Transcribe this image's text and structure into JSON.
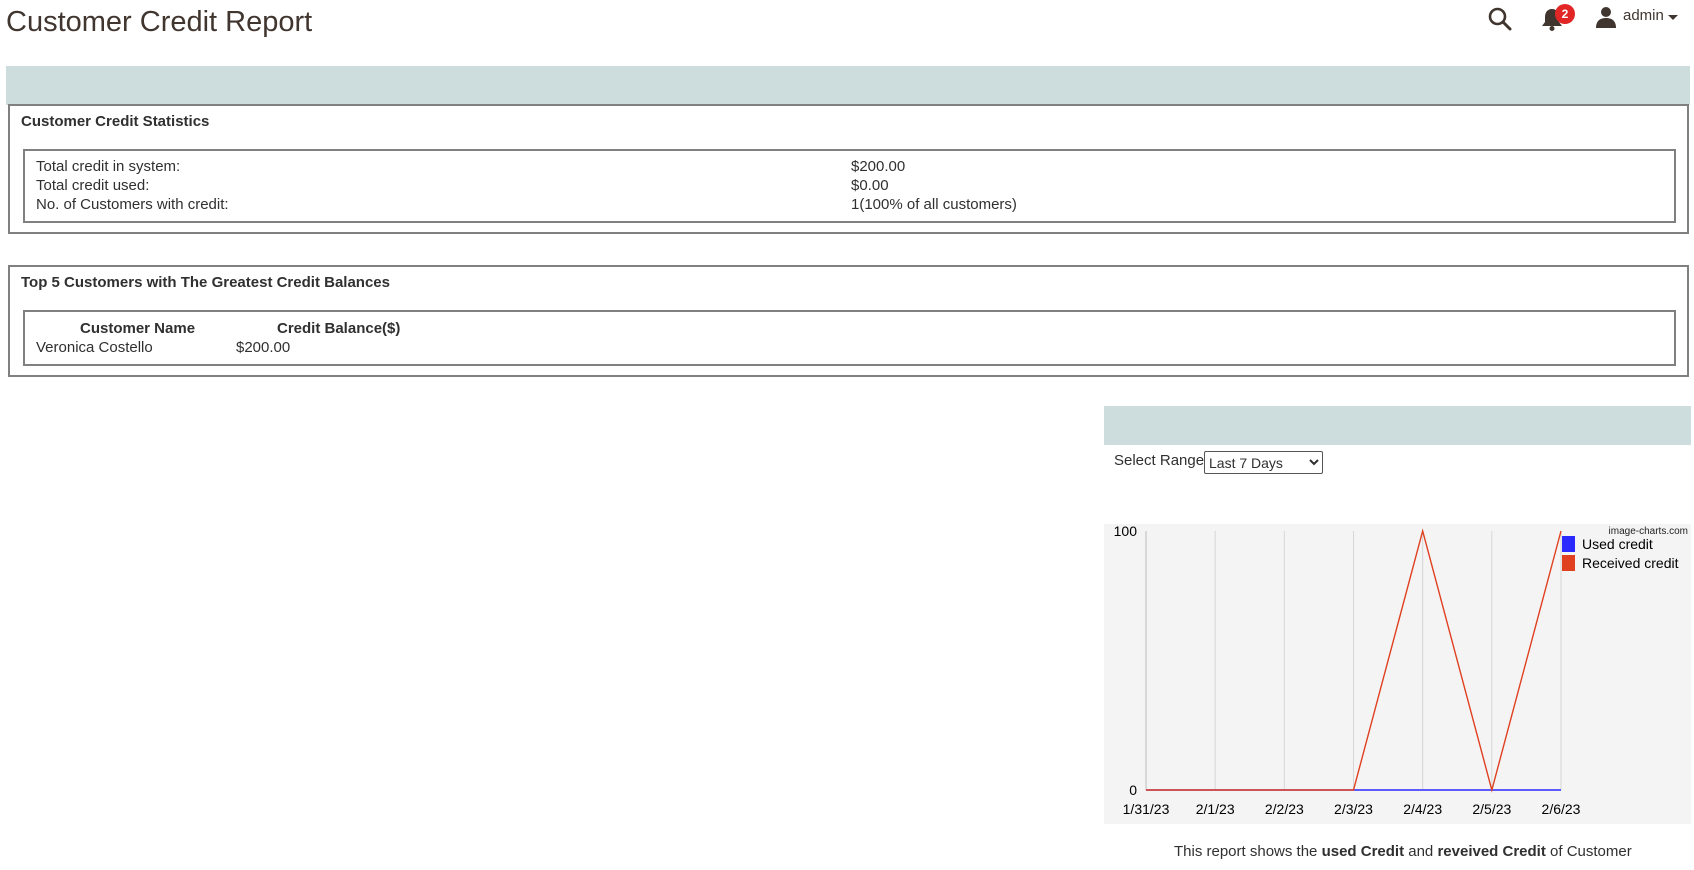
{
  "page": {
    "title": "Customer Credit Report"
  },
  "header": {
    "notification_count": "2",
    "user_name": "admin",
    "icons": {
      "search": "search-icon",
      "bell": "bell-icon",
      "user": "user-icon",
      "caret": "chevron-down-icon"
    }
  },
  "stats": {
    "title": "Customer Credit Statistics",
    "rows": [
      {
        "label": "Total credit in system:",
        "value": "$200.00"
      },
      {
        "label": "Total credit used:",
        "value": "$0.00"
      },
      {
        "label": "No. of Customers with credit:",
        "value": "1(100% of all customers)"
      }
    ]
  },
  "top5": {
    "title": "Top 5 Customers with The Greatest Credit Balances",
    "headers": [
      "Customer Name",
      "Credit Balance($)"
    ],
    "rows": [
      {
        "name": "Veronica Costello",
        "balance": "$200.00"
      }
    ]
  },
  "range": {
    "label": "Select Range:",
    "selected": "Last 7 Days"
  },
  "chart_data": {
    "type": "line",
    "categories": [
      "1/31/23",
      "2/1/23",
      "2/2/23",
      "2/3/23",
      "2/4/23",
      "2/5/23",
      "2/6/23"
    ],
    "series": [
      {
        "name": "Used credit",
        "color": "#2a2aff",
        "values": [
          0,
          0,
          0,
          0,
          0,
          0,
          0
        ]
      },
      {
        "name": "Received credit",
        "color": "#e04020",
        "values": [
          0,
          0,
          0,
          0,
          100,
          0,
          100
        ]
      }
    ],
    "ylim": [
      0,
      100
    ],
    "yticks": [
      "0",
      "100"
    ],
    "watermark": "image-charts.com",
    "legend": "top-right",
    "grid": true
  },
  "caption": {
    "prefix": "This report shows the ",
    "used": "used Credit",
    "and": " and ",
    "received": "reveived Credit",
    "suffix": " of Customer"
  }
}
